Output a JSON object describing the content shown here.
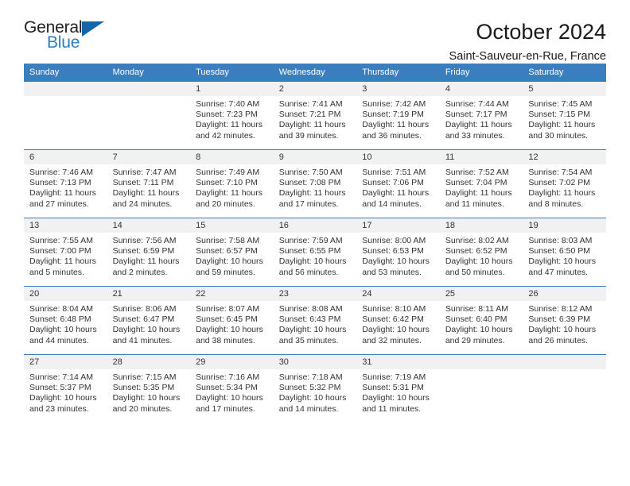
{
  "brand": {
    "name_top": "General",
    "name_bottom": "Blue",
    "triangle_color": "#1665a8",
    "blue_color": "#2a7fc1",
    "dark_color": "#231f20"
  },
  "header": {
    "title": "October 2024",
    "subtitle": "Saint-Sauveur-en-Rue, France"
  },
  "theme": {
    "header_blue": "#3a7ebf",
    "daynum_band": "#f1f1f1",
    "text": "#333333"
  },
  "calendar": {
    "weekday_headers": [
      "Sunday",
      "Monday",
      "Tuesday",
      "Wednesday",
      "Thursday",
      "Friday",
      "Saturday"
    ],
    "labels": {
      "sunrise_prefix": "Sunrise:",
      "sunset_prefix": "Sunset:",
      "daylight_prefix": "Daylight:"
    },
    "weeks": [
      [
        {
          "day": "",
          "sunrise": "",
          "sunset": "",
          "daylight": ""
        },
        {
          "day": "",
          "sunrise": "",
          "sunset": "",
          "daylight": ""
        },
        {
          "day": "1",
          "sunrise": "Sunrise: 7:40 AM",
          "sunset": "Sunset: 7:23 PM",
          "daylight": "Daylight: 11 hours and 42 minutes."
        },
        {
          "day": "2",
          "sunrise": "Sunrise: 7:41 AM",
          "sunset": "Sunset: 7:21 PM",
          "daylight": "Daylight: 11 hours and 39 minutes."
        },
        {
          "day": "3",
          "sunrise": "Sunrise: 7:42 AM",
          "sunset": "Sunset: 7:19 PM",
          "daylight": "Daylight: 11 hours and 36 minutes."
        },
        {
          "day": "4",
          "sunrise": "Sunrise: 7:44 AM",
          "sunset": "Sunset: 7:17 PM",
          "daylight": "Daylight: 11 hours and 33 minutes."
        },
        {
          "day": "5",
          "sunrise": "Sunrise: 7:45 AM",
          "sunset": "Sunset: 7:15 PM",
          "daylight": "Daylight: 11 hours and 30 minutes."
        }
      ],
      [
        {
          "day": "6",
          "sunrise": "Sunrise: 7:46 AM",
          "sunset": "Sunset: 7:13 PM",
          "daylight": "Daylight: 11 hours and 27 minutes."
        },
        {
          "day": "7",
          "sunrise": "Sunrise: 7:47 AM",
          "sunset": "Sunset: 7:11 PM",
          "daylight": "Daylight: 11 hours and 24 minutes."
        },
        {
          "day": "8",
          "sunrise": "Sunrise: 7:49 AM",
          "sunset": "Sunset: 7:10 PM",
          "daylight": "Daylight: 11 hours and 20 minutes."
        },
        {
          "day": "9",
          "sunrise": "Sunrise: 7:50 AM",
          "sunset": "Sunset: 7:08 PM",
          "daylight": "Daylight: 11 hours and 17 minutes."
        },
        {
          "day": "10",
          "sunrise": "Sunrise: 7:51 AM",
          "sunset": "Sunset: 7:06 PM",
          "daylight": "Daylight: 11 hours and 14 minutes."
        },
        {
          "day": "11",
          "sunrise": "Sunrise: 7:52 AM",
          "sunset": "Sunset: 7:04 PM",
          "daylight": "Daylight: 11 hours and 11 minutes."
        },
        {
          "day": "12",
          "sunrise": "Sunrise: 7:54 AM",
          "sunset": "Sunset: 7:02 PM",
          "daylight": "Daylight: 11 hours and 8 minutes."
        }
      ],
      [
        {
          "day": "13",
          "sunrise": "Sunrise: 7:55 AM",
          "sunset": "Sunset: 7:00 PM",
          "daylight": "Daylight: 11 hours and 5 minutes."
        },
        {
          "day": "14",
          "sunrise": "Sunrise: 7:56 AM",
          "sunset": "Sunset: 6:59 PM",
          "daylight": "Daylight: 11 hours and 2 minutes."
        },
        {
          "day": "15",
          "sunrise": "Sunrise: 7:58 AM",
          "sunset": "Sunset: 6:57 PM",
          "daylight": "Daylight: 10 hours and 59 minutes."
        },
        {
          "day": "16",
          "sunrise": "Sunrise: 7:59 AM",
          "sunset": "Sunset: 6:55 PM",
          "daylight": "Daylight: 10 hours and 56 minutes."
        },
        {
          "day": "17",
          "sunrise": "Sunrise: 8:00 AM",
          "sunset": "Sunset: 6:53 PM",
          "daylight": "Daylight: 10 hours and 53 minutes."
        },
        {
          "day": "18",
          "sunrise": "Sunrise: 8:02 AM",
          "sunset": "Sunset: 6:52 PM",
          "daylight": "Daylight: 10 hours and 50 minutes."
        },
        {
          "day": "19",
          "sunrise": "Sunrise: 8:03 AM",
          "sunset": "Sunset: 6:50 PM",
          "daylight": "Daylight: 10 hours and 47 minutes."
        }
      ],
      [
        {
          "day": "20",
          "sunrise": "Sunrise: 8:04 AM",
          "sunset": "Sunset: 6:48 PM",
          "daylight": "Daylight: 10 hours and 44 minutes."
        },
        {
          "day": "21",
          "sunrise": "Sunrise: 8:06 AM",
          "sunset": "Sunset: 6:47 PM",
          "daylight": "Daylight: 10 hours and 41 minutes."
        },
        {
          "day": "22",
          "sunrise": "Sunrise: 8:07 AM",
          "sunset": "Sunset: 6:45 PM",
          "daylight": "Daylight: 10 hours and 38 minutes."
        },
        {
          "day": "23",
          "sunrise": "Sunrise: 8:08 AM",
          "sunset": "Sunset: 6:43 PM",
          "daylight": "Daylight: 10 hours and 35 minutes."
        },
        {
          "day": "24",
          "sunrise": "Sunrise: 8:10 AM",
          "sunset": "Sunset: 6:42 PM",
          "daylight": "Daylight: 10 hours and 32 minutes."
        },
        {
          "day": "25",
          "sunrise": "Sunrise: 8:11 AM",
          "sunset": "Sunset: 6:40 PM",
          "daylight": "Daylight: 10 hours and 29 minutes."
        },
        {
          "day": "26",
          "sunrise": "Sunrise: 8:12 AM",
          "sunset": "Sunset: 6:39 PM",
          "daylight": "Daylight: 10 hours and 26 minutes."
        }
      ],
      [
        {
          "day": "27",
          "sunrise": "Sunrise: 7:14 AM",
          "sunset": "Sunset: 5:37 PM",
          "daylight": "Daylight: 10 hours and 23 minutes."
        },
        {
          "day": "28",
          "sunrise": "Sunrise: 7:15 AM",
          "sunset": "Sunset: 5:35 PM",
          "daylight": "Daylight: 10 hours and 20 minutes."
        },
        {
          "day": "29",
          "sunrise": "Sunrise: 7:16 AM",
          "sunset": "Sunset: 5:34 PM",
          "daylight": "Daylight: 10 hours and 17 minutes."
        },
        {
          "day": "30",
          "sunrise": "Sunrise: 7:18 AM",
          "sunset": "Sunset: 5:32 PM",
          "daylight": "Daylight: 10 hours and 14 minutes."
        },
        {
          "day": "31",
          "sunrise": "Sunrise: 7:19 AM",
          "sunset": "Sunset: 5:31 PM",
          "daylight": "Daylight: 10 hours and 11 minutes."
        },
        {
          "day": "",
          "sunrise": "",
          "sunset": "",
          "daylight": ""
        },
        {
          "day": "",
          "sunrise": "",
          "sunset": "",
          "daylight": ""
        }
      ]
    ]
  }
}
